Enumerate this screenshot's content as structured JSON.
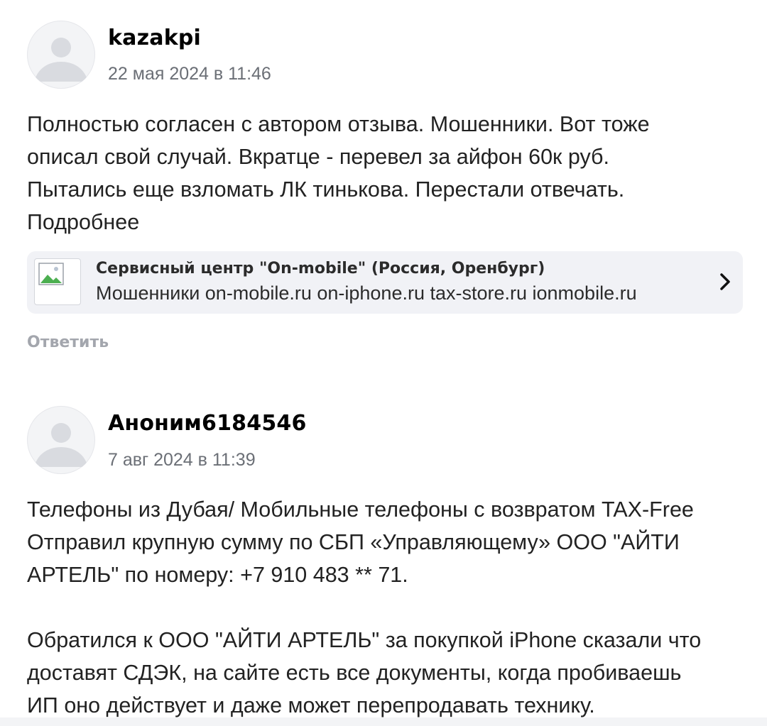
{
  "comments": [
    {
      "author": "kazakpi",
      "date": "22 мая 2024 в 11:46",
      "lines": [
        "Полностью согласен с автором отзыва. Мошенники. Вот тоже",
        "описал свой случай. Вкратце - перевел за айфон 60к руб.",
        "Пытались еще взломать ЛК тинькова. Перестали отвечать.",
        "Подробнее"
      ],
      "link": {
        "title": "Сервисный центр \"On-mobile\" (Россия, Оренбург)",
        "description": "Мошенники on-mobile.ru on-iphone.ru tax-store.ru ionmobile.ru"
      },
      "reply_label": "Ответить"
    },
    {
      "author": "Аноним6184546",
      "date": "7 авг 2024 в 11:39",
      "lines": [
        "Телефоны из Дубая/ Мобильные телефоны с возвратом TAX-Free",
        "Отправил крупную сумму по СБП «Управляющему» ООО \"АЙТИ",
        "АРТЕЛЬ\" по номеру: +7 910 483 ** 71.",
        "",
        "Обратился к ООО \"АЙТИ АРТЕЛЬ\" за покупкой iPhone сказали что",
        "доставят СДЭК, на сайте есть все документы, когда пробиваешь",
        "ИП оно действует и даже может перепродавать технику."
      ]
    }
  ],
  "icons": {
    "avatar": "user-silhouette-icon",
    "link_thumb": "broken-image-icon",
    "chevron": "chevron-right-icon"
  },
  "colors": {
    "author": "#000000",
    "date": "#6b6f76",
    "text": "#222222",
    "reply": "#a3a6ad",
    "card_bg": "#f1f2f6",
    "avatar_bg": "#f3f4f6",
    "avatar_figure": "#d9dbe0"
  }
}
